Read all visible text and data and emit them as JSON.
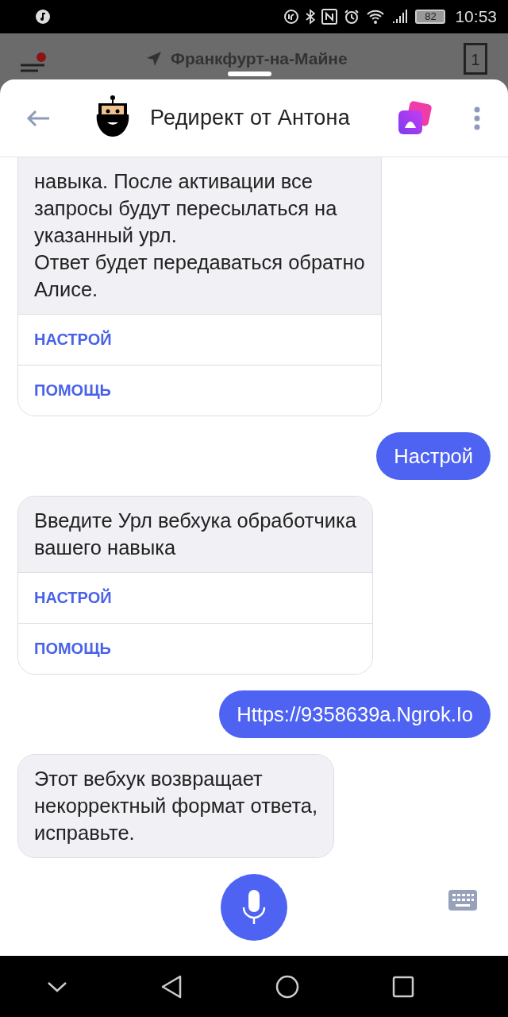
{
  "status_bar": {
    "battery": "82",
    "time": "10:53"
  },
  "background": {
    "unread": true,
    "location": "Франкфурт-на-Майне",
    "tab_count": "1"
  },
  "header": {
    "title": "Редирект от Антона"
  },
  "messages": [
    {
      "kind": "skill",
      "text": "навыка. После активации все\nзапросы будут пересылаться на\nуказанный урл.\nОтвет будет передаваться обратно\nАлисе.",
      "buttons": [
        "НАСТРОЙ",
        "ПОМОЩЬ"
      ]
    },
    {
      "kind": "user",
      "text": "Настрой"
    },
    {
      "kind": "skill",
      "text": "Введите Урл вебхука обработчика\nвашего навыка",
      "buttons": [
        "НАСТРОЙ",
        "ПОМОЩЬ"
      ]
    },
    {
      "kind": "user",
      "text": "Https://9358639a.Ngrok.Io"
    },
    {
      "kind": "skill",
      "text": "Этот вебхук возвращает\nнекорректный формат ответа,\nисправьте."
    }
  ]
}
